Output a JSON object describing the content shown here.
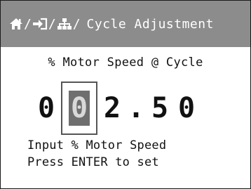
{
  "header": {
    "breadcrumb_icons": [
      "home-icon",
      "login-arrow-icon",
      "network-icon"
    ],
    "separator": "/",
    "title": "Cycle Adjustment",
    "background": "#8c8c8c"
  },
  "main": {
    "subtitle": "% Motor Speed @ Cycle",
    "value": {
      "digits": [
        "0",
        "0",
        "2",
        ".",
        "5",
        "0"
      ],
      "selected_index": 1
    },
    "instruction_1": "Input % Motor Speed",
    "instruction_2": "Press ENTER to set"
  }
}
